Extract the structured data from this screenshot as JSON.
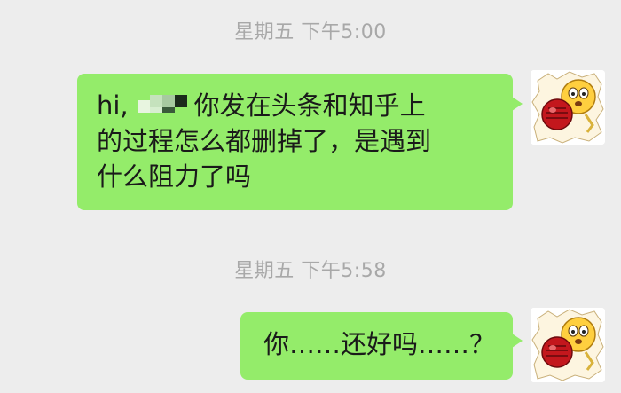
{
  "chat": {
    "timestamps": [
      "星期五 下午5:00",
      "星期五 下午5:58"
    ],
    "messages": [
      {
        "greeting": "hi,",
        "line1_rest": "你发在头条和知乎上",
        "line2": "的过程怎么都删掉了，是遇到",
        "line3": "什么阻力了吗"
      },
      {
        "text": "你……还好吗……？"
      }
    ],
    "avatar_icon": "saitama-punch-icon",
    "bubble_color": "#94ec6a",
    "background_color": "#ededed"
  }
}
